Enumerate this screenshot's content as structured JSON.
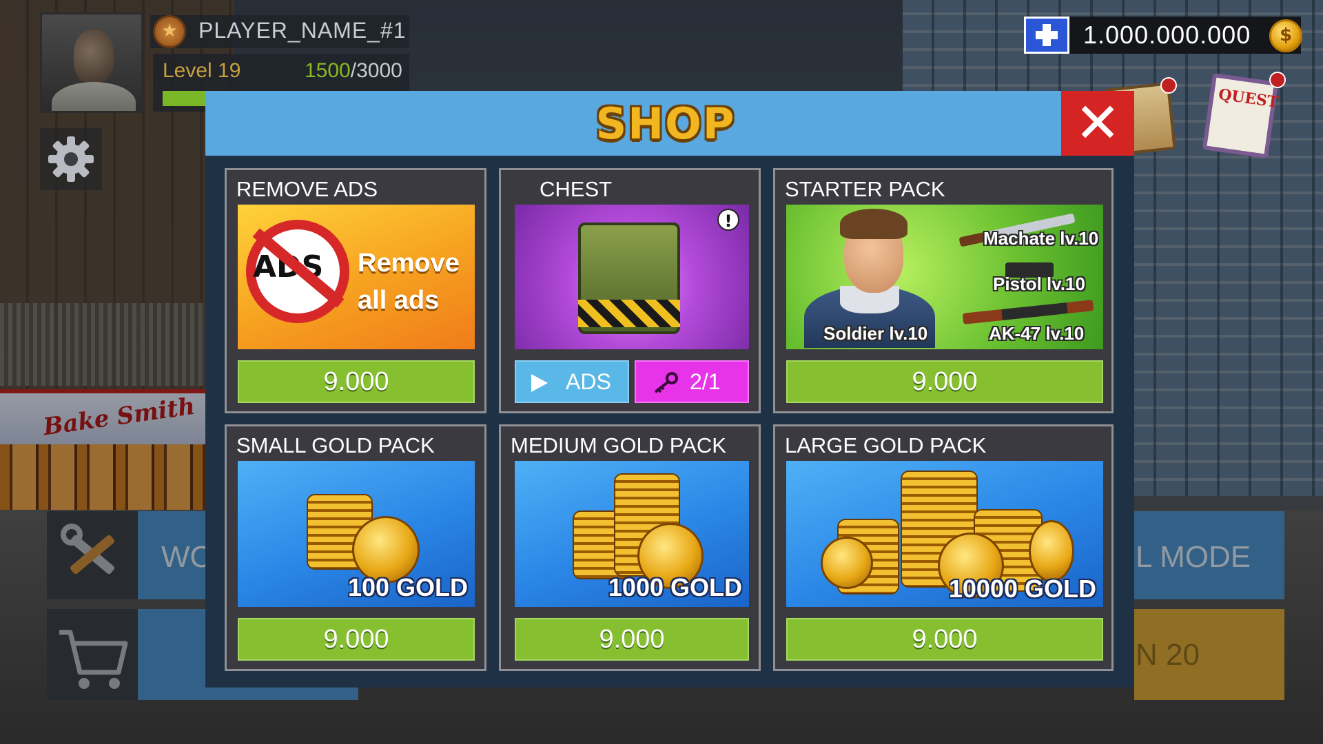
{
  "hud": {
    "player_name": "PLAYER_NAME_#1",
    "level_label": "Level 19",
    "xp_current": "1500",
    "xp_separator": "/",
    "xp_max": "3000",
    "xp_progress": 0.5,
    "gold_amount": "1.000.000.000",
    "gold_coin_symbol": "$",
    "quest_label": "QUEST"
  },
  "background": {
    "store_sign": "Bake Smith",
    "menu_left_text": "WO",
    "menu_right_text": "L MODE",
    "menu_right2_text": "N 20"
  },
  "shop": {
    "title": "SHOP",
    "close_symbol": "✕",
    "cards": [
      {
        "title": "REMOVE ADS",
        "art_badge": "ADS",
        "art_text_line1": "Remove",
        "art_text_line2": "all ads",
        "price": "9.000"
      },
      {
        "title": "CHEST",
        "ads_label": "ADS",
        "keys_label": "2/1"
      },
      {
        "title": "STARTER PACK",
        "items": [
          "Machate lv.10",
          "Pistol lv.10",
          "AK-47 lv.10",
          "Soldier lv.10"
        ],
        "price": "9.000"
      },
      {
        "title": "SMALL GOLD PACK",
        "amount_label": "100 GOLD",
        "price": "9.000"
      },
      {
        "title": "MEDIUM GOLD PACK",
        "amount_label": "1000 GOLD",
        "price": "9.000"
      },
      {
        "title": "LARGE GOLD PACK",
        "amount_label": "10000 GOLD",
        "price": "9.000"
      }
    ]
  },
  "colors": {
    "shop_header": "#5aa8e0",
    "shop_title": "#f2b620",
    "close_button": "#d42424",
    "price_button": "#86c030",
    "ads_button": "#5ab8e8",
    "keys_button": "#e834e8",
    "modal_bg": "#1f3144"
  }
}
